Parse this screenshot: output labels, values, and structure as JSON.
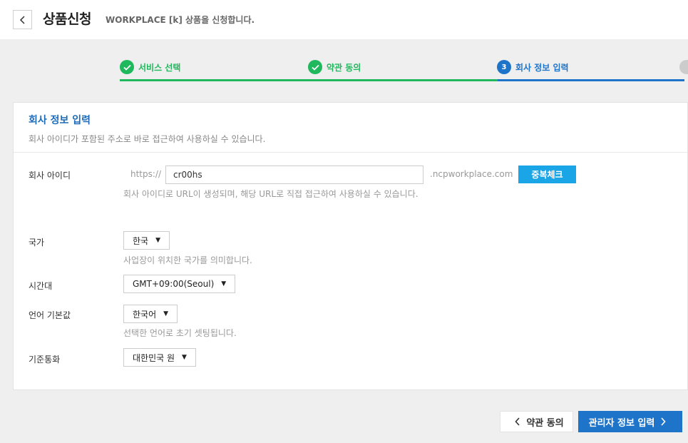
{
  "header": {
    "title": "상품신청",
    "subtitle": "WORKPLACE [k] 상품을 신청합니다."
  },
  "steps": [
    {
      "label": "서비스 선택",
      "state": "done"
    },
    {
      "label": "약관 동의",
      "state": "done"
    },
    {
      "label": "회사 정보 입력",
      "state": "active",
      "number": "3"
    }
  ],
  "colors": {
    "done": "#1fb85c",
    "active": "#1e74c9",
    "accent_button": "#1aa5e6"
  },
  "card": {
    "title": "회사 정보 입력",
    "description": "회사 아이디가 포함된 주소로 바로 접근하여 사용하실 수 있습니다."
  },
  "company_id": {
    "label": "회사 아이디",
    "prefix": "https://",
    "value": "cr00hs",
    "suffix": ".ncpworkplace.com",
    "check_button": "중복체크",
    "help": "회사 아이디로 URL이 생성되며, 해당 URL로 직접 접근하여 사용하실 수 있습니다."
  },
  "country": {
    "label": "국가",
    "value": "한국",
    "help": "사업장이 위치한 국가를 의미합니다."
  },
  "timezone": {
    "label": "시간대",
    "value": "GMT+09:00(Seoul)"
  },
  "language": {
    "label": "언어 기본값",
    "value": "한국어",
    "help": "선택한 언어로 초기 셋팅됩니다."
  },
  "currency": {
    "label": "기준통화",
    "value": "대한민국 원"
  },
  "footer": {
    "prev_button": "약관 동의",
    "next_button": "관리자 정보 입력"
  }
}
